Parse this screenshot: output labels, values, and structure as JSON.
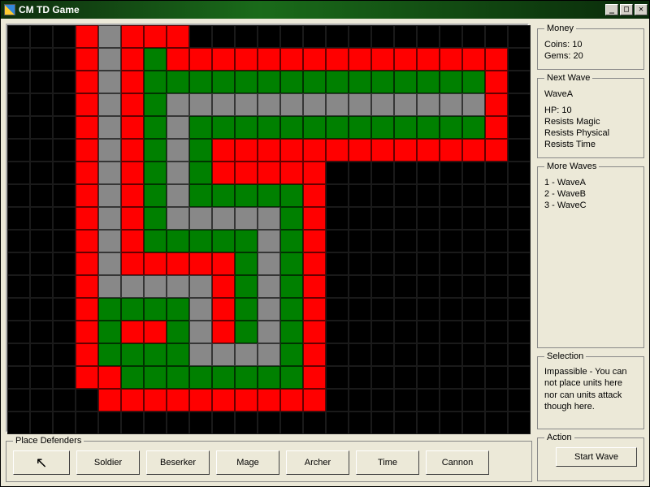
{
  "window": {
    "title": "CM TD Game",
    "min_glyph": "_",
    "max_glyph": "□",
    "close_glyph": "✕"
  },
  "map": {
    "cols": 23,
    "rows": 18,
    "legend": {
      "K": "black",
      "R": "red",
      "G": "green",
      "Y": "gray"
    },
    "rows_data": [
      "KKKRYRRRKKKKKKKKKKKKKKK",
      "KKKRYRGRRRRRRRRRRRRRRRK",
      "KKKRYRGGGGGGGGGGGGGGGRK",
      "KKKRYRGYYYYYYYYYYYYYYRK",
      "KKKRYRGYGGGGGGGGGGGGGRK",
      "KKKRYRGYGRRRRRRRRRRRRRK",
      "KKKRYRGYGRRRRRKKKKKKKKK",
      "KKKRYRGYGGGGGRKKKKKKKKK",
      "KKKRYRGYYYYYGRKKKKKKKKK",
      "KKKRYRGGGGGYGRKKKKKKKKK",
      "KKKRYRRRRRGYGRKKKKKKKKK",
      "KKKRYYYYYRGYGRKKKKKKKKK",
      "KKKRGGGGYRGYGRKKKKKKKKK",
      "KKKRGRRGYRGYGRKKKKKKKKK",
      "KKKRGGGGYYYYGRKKKKKKKKK",
      "KKKRRGGGGGGGGRKKKKKKKKK",
      "KKKKRRRRRRRRRRKKKKKKKKK",
      "KKKKKKKKKKKKKKKKKKKKKKK"
    ]
  },
  "defenders": {
    "group_label": "Place Defenders",
    "pointer_icon": "↖",
    "buttons": [
      "Soldier",
      "Beserker",
      "Mage",
      "Archer",
      "Time",
      "Cannon"
    ]
  },
  "money": {
    "group_label": "Money",
    "coins_label": "Coins:",
    "coins": 10,
    "gems_label": "Gems:",
    "gems": 20
  },
  "next_wave": {
    "group_label": "Next Wave",
    "name": "WaveA",
    "hp_label": "HP:",
    "hp": 10,
    "resist1": "Resists Magic",
    "resist2": "Resists Physical",
    "resist3": "Resists Time"
  },
  "more_waves": {
    "group_label": "More Waves",
    "items": [
      "1 - WaveA",
      "2 - WaveB",
      "3 - WaveC"
    ]
  },
  "selection": {
    "group_label": "Selection",
    "text": "Impassible - You can not place units here nor can units attack though here."
  },
  "action": {
    "group_label": "Action",
    "start_label": "Start Wave"
  }
}
